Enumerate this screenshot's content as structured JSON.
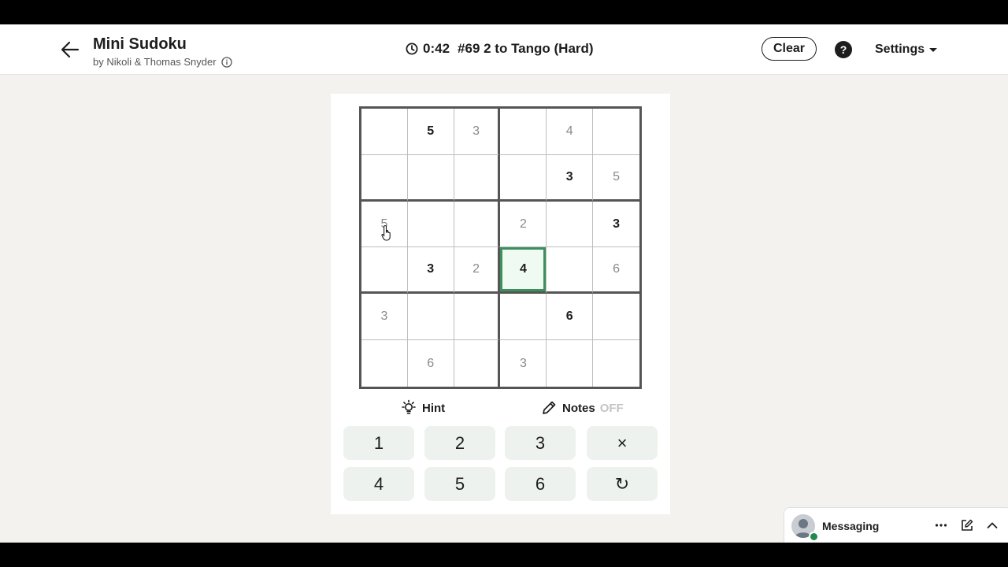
{
  "header": {
    "title": "Mini Sudoku",
    "byline": "by Nikoli & Thomas Snyder",
    "timer": "0:42",
    "puzzle": "#69 2 to Tango (Hard)",
    "clear_label": "Clear",
    "help_label": "?",
    "settings_label": "Settings"
  },
  "board": {
    "rows": [
      [
        {
          "v": ""
        },
        {
          "v": "5",
          "t": "given"
        },
        {
          "v": "3",
          "t": "user"
        },
        {
          "v": ""
        },
        {
          "v": "4",
          "t": "user"
        },
        {
          "v": ""
        }
      ],
      [
        {
          "v": ""
        },
        {
          "v": ""
        },
        {
          "v": ""
        },
        {
          "v": ""
        },
        {
          "v": "3",
          "t": "given"
        },
        {
          "v": "5",
          "t": "user"
        }
      ],
      [
        {
          "v": "5",
          "t": "user"
        },
        {
          "v": ""
        },
        {
          "v": ""
        },
        {
          "v": "2",
          "t": "user"
        },
        {
          "v": ""
        },
        {
          "v": "3",
          "t": "given"
        }
      ],
      [
        {
          "v": ""
        },
        {
          "v": "3",
          "t": "given"
        },
        {
          "v": "2",
          "t": "user"
        },
        {
          "v": "4",
          "t": "given",
          "selected": true
        },
        {
          "v": ""
        },
        {
          "v": "6",
          "t": "user"
        }
      ],
      [
        {
          "v": "3",
          "t": "user"
        },
        {
          "v": ""
        },
        {
          "v": ""
        },
        {
          "v": ""
        },
        {
          "v": "6",
          "t": "given"
        },
        {
          "v": ""
        }
      ],
      [
        {
          "v": ""
        },
        {
          "v": "6",
          "t": "user"
        },
        {
          "v": ""
        },
        {
          "v": "3",
          "t": "user"
        },
        {
          "v": ""
        },
        {
          "v": ""
        }
      ]
    ]
  },
  "tools": {
    "hint_label": "Hint",
    "notes_label": "Notes",
    "notes_state": "OFF"
  },
  "keypad": [
    "1",
    "2",
    "3",
    "×",
    "4",
    "5",
    "6",
    "↻"
  ],
  "messaging": {
    "label": "Messaging"
  },
  "colors": {
    "selected_border": "#3e8f5e",
    "selected_fill": "#eefaf2",
    "key_bg": "#eef2ef"
  }
}
